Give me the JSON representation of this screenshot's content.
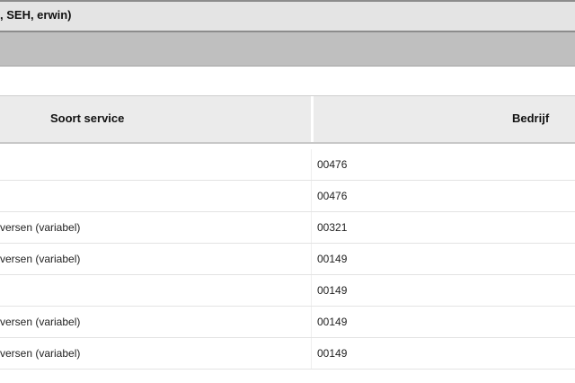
{
  "window": {
    "title": ", SEH, erwin)"
  },
  "table": {
    "headers": {
      "service": "Soort service",
      "bedrijf": "Bedrijf"
    },
    "rows": [
      {
        "service": "",
        "bedrijf": "00476"
      },
      {
        "service": "",
        "bedrijf": "00476"
      },
      {
        "service": "versen (variabel)",
        "bedrijf": "00321"
      },
      {
        "service": "versen (variabel)",
        "bedrijf": "00149"
      },
      {
        "service": "",
        "bedrijf": "00149"
      },
      {
        "service": "versen (variabel)",
        "bedrijf": "00149"
      },
      {
        "service": "versen (variabel)",
        "bedrijf": "00149"
      }
    ]
  }
}
